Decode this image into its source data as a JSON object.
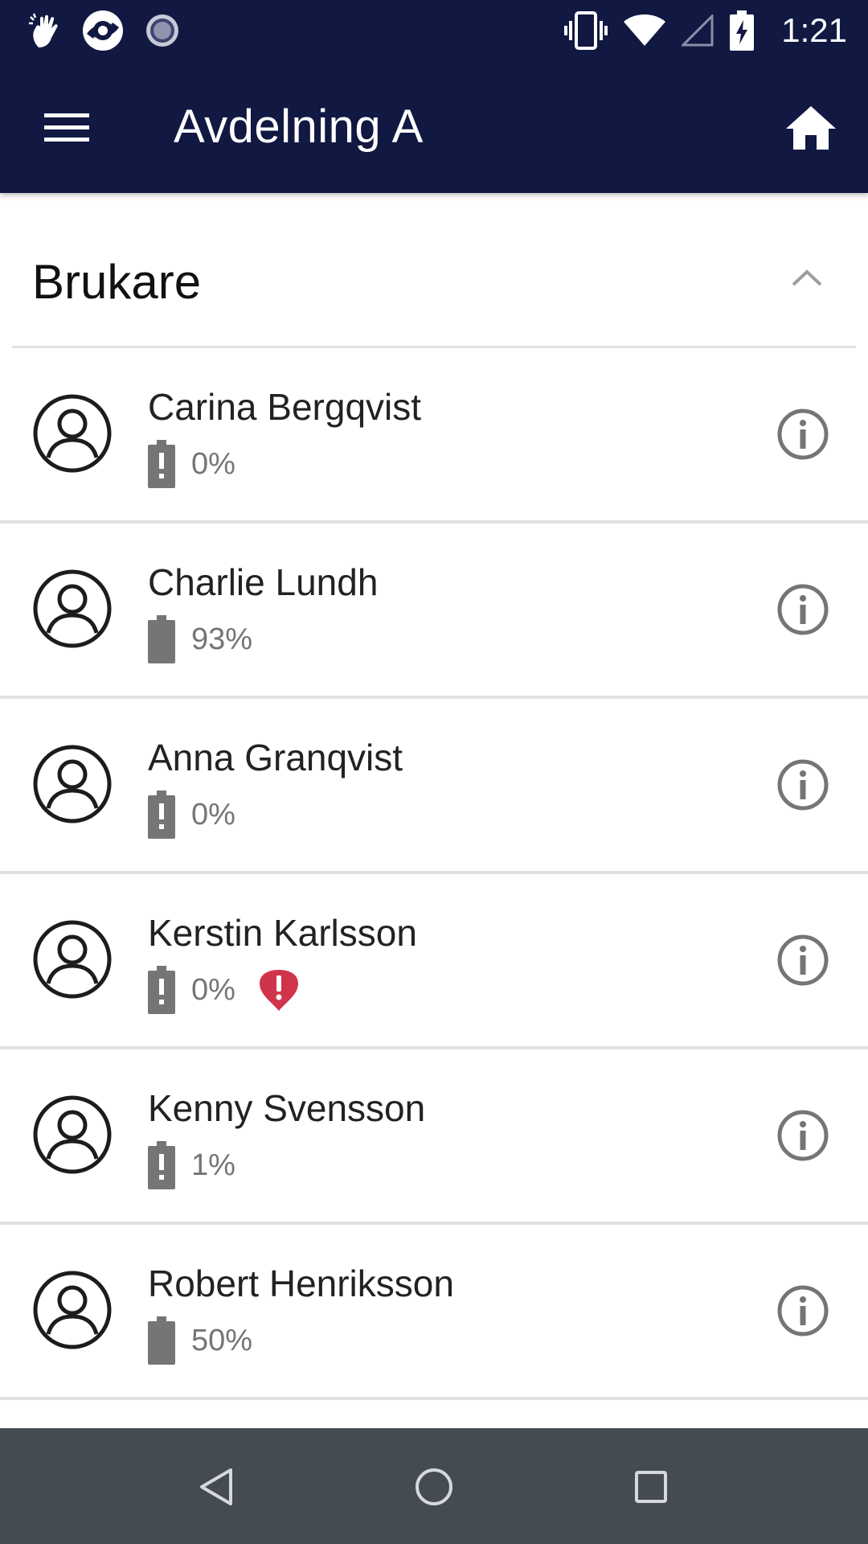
{
  "status_bar": {
    "time": "1:21",
    "left_icons": [
      "touch-icon",
      "app-logo-icon",
      "loading-spinner-icon"
    ],
    "right_icons": [
      "vibrate-icon",
      "wifi-icon",
      "signal-icon",
      "battery-charging-icon"
    ]
  },
  "app_bar": {
    "title": "Avdelning A",
    "menu_icon": "hamburger-menu-icon",
    "home_icon": "home-icon"
  },
  "section": {
    "title": "Brukare",
    "toggle_icon": "chevron-up-icon"
  },
  "users": [
    {
      "name": "Carina Bergqvist",
      "battery": "0%",
      "battery_state": "alert",
      "alarm": false
    },
    {
      "name": "Charlie Lundh",
      "battery": "93%",
      "battery_state": "full",
      "alarm": false
    },
    {
      "name": "Anna Granqvist",
      "battery": "0%",
      "battery_state": "alert",
      "alarm": false
    },
    {
      "name": "Kerstin Karlsson",
      "battery": "0%",
      "battery_state": "alert",
      "alarm": true
    },
    {
      "name": "Kenny Svensson",
      "battery": "1%",
      "battery_state": "alert",
      "alarm": false
    },
    {
      "name": "Robert Henriksson",
      "battery": "50%",
      "battery_state": "full",
      "alarm": false
    }
  ],
  "nav_bar": {
    "icons": [
      "back-icon",
      "home-circle-icon",
      "recents-icon"
    ]
  },
  "colors": {
    "primary": "#111842",
    "nav": "#454b52",
    "divider": "#e1e1e1",
    "alert": "#d0344b",
    "muted": "#757575"
  }
}
